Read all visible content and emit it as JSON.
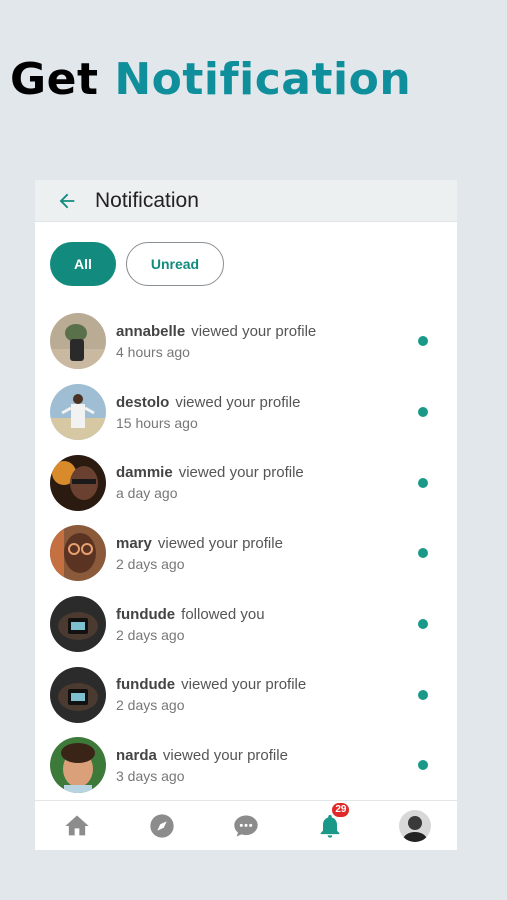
{
  "promo": {
    "title_plain": "Get",
    "title_accent": "Notification"
  },
  "appbar": {
    "title": "Notification"
  },
  "filters": {
    "all_label": "All",
    "unread_label": "Unread"
  },
  "notifications": [
    {
      "name": "annabelle",
      "action": "viewed your profile",
      "time": "4 hours ago"
    },
    {
      "name": "destolo",
      "action": "viewed your profile",
      "time": "15 hours ago"
    },
    {
      "name": "dammie",
      "action": "viewed your profile",
      "time": "a day ago"
    },
    {
      "name": "mary",
      "action": "viewed your profile",
      "time": "2 days ago"
    },
    {
      "name": "fundude",
      "action": "followed you",
      "time": "2 days ago"
    },
    {
      "name": "fundude",
      "action": "viewed your profile",
      "time": "2 days ago"
    },
    {
      "name": "narda",
      "action": "viewed your profile",
      "time": "3 days ago"
    }
  ],
  "bottom_nav": {
    "items": [
      "home-icon",
      "compass-icon",
      "chat-icon",
      "bell-icon",
      "profile-avatar"
    ],
    "badge_count": "29"
  },
  "colors": {
    "accent": "#128b7e",
    "title_accent": "#0e8f9b",
    "unread_dot": "#1a9988",
    "badge": "#e02a2a"
  }
}
